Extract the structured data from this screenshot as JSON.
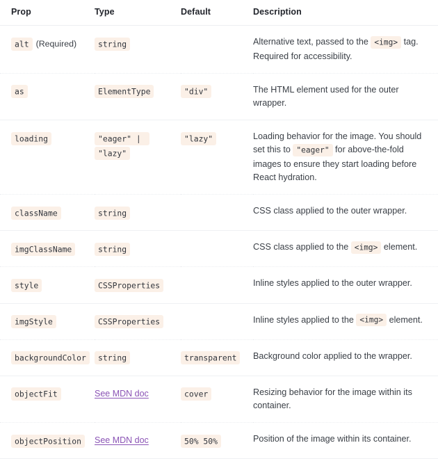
{
  "table": {
    "headers": [
      "Prop",
      "Type",
      "Default",
      "Description"
    ],
    "colors": {
      "code_chip_bg": "#fbf0e7",
      "code_chip_text": "#32363d",
      "link": "#8a53b5",
      "header_text": "#22252c",
      "body_text": "#3a3f46",
      "row_divider": "#eff0f3",
      "page_bg": "#ffffff"
    },
    "rows": [
      {
        "prop": "alt",
        "prop_note": "(Required)",
        "type": "string",
        "default": "",
        "description_parts": [
          {
            "kind": "text",
            "value": "Alternative text, passed to the "
          },
          {
            "kind": "code",
            "value": "<img>"
          },
          {
            "kind": "text",
            "value": " tag. Required for accessibility."
          }
        ]
      },
      {
        "prop": "as",
        "prop_note": "",
        "type": "ElementType",
        "default": "\"div\"",
        "description_parts": [
          {
            "kind": "text",
            "value": "The HTML element used for the outer wrapper."
          }
        ]
      },
      {
        "prop": "loading",
        "prop_note": "",
        "type": "\"eager\" | \"lazy\"",
        "default": "\"lazy\"",
        "description_parts": [
          {
            "kind": "text",
            "value": "Loading behavior for the image. You should set this to "
          },
          {
            "kind": "code",
            "value": "\"eager\""
          },
          {
            "kind": "text",
            "value": " for above-the-fold images to ensure they start loading before React hydration."
          }
        ]
      },
      {
        "prop": "className",
        "prop_note": "",
        "type": "string",
        "default": "",
        "description_parts": [
          {
            "kind": "text",
            "value": "CSS class applied to the outer wrapper."
          }
        ]
      },
      {
        "prop": "imgClassName",
        "prop_note": "",
        "type": "string",
        "default": "",
        "description_parts": [
          {
            "kind": "text",
            "value": "CSS class applied to the "
          },
          {
            "kind": "code",
            "value": "<img>"
          },
          {
            "kind": "text",
            "value": " element."
          }
        ]
      },
      {
        "prop": "style",
        "prop_note": "",
        "type": "CSSProperties",
        "default": "",
        "description_parts": [
          {
            "kind": "text",
            "value": "Inline styles applied to the outer wrapper."
          }
        ]
      },
      {
        "prop": "imgStyle",
        "prop_note": "",
        "type": "CSSProperties",
        "default": "",
        "description_parts": [
          {
            "kind": "text",
            "value": "Inline styles applied to the "
          },
          {
            "kind": "code",
            "value": "<img>"
          },
          {
            "kind": "text",
            "value": " element."
          }
        ]
      },
      {
        "prop": "backgroundColor",
        "prop_note": "",
        "type": "string",
        "default": "transparent",
        "description_parts": [
          {
            "kind": "text",
            "value": "Background color applied to the wrapper."
          }
        ]
      },
      {
        "prop": "objectFit",
        "prop_note": "",
        "type_link": "See MDN doc",
        "default": "cover",
        "description_parts": [
          {
            "kind": "text",
            "value": "Resizing behavior for the image within its container."
          }
        ]
      },
      {
        "prop": "objectPosition",
        "prop_note": "",
        "type_link": "See MDN doc",
        "default": "50% 50%",
        "description_parts": [
          {
            "kind": "text",
            "value": "Position of the image within its container."
          }
        ]
      }
    ]
  }
}
